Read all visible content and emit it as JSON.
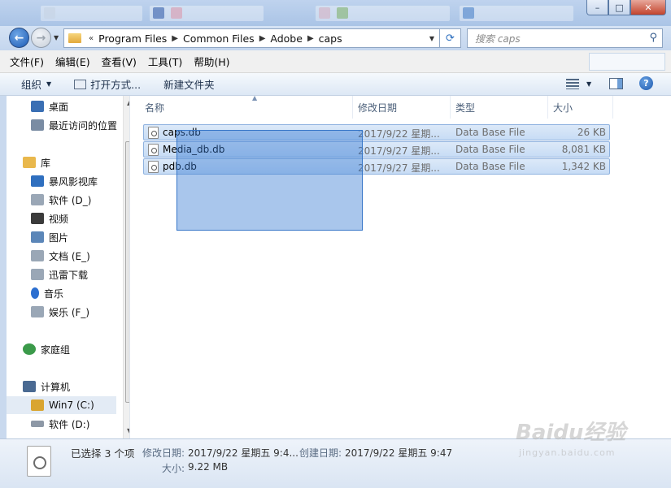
{
  "window": {
    "caption_buttons": {
      "minimize": "–",
      "maximize": "□",
      "close": "✕"
    }
  },
  "address": {
    "overflow": "«",
    "breadcrumbs": [
      "Program Files",
      "Common Files",
      "Adobe",
      "caps"
    ],
    "search_placeholder": "搜索 caps"
  },
  "menu": [
    "文件(F)",
    "编辑(E)",
    "查看(V)",
    "工具(T)",
    "帮助(H)"
  ],
  "toolbar": {
    "organize": "组织",
    "open_with": "打开方式...",
    "new_folder": "新建文件夹"
  },
  "nav_pane": {
    "items": [
      {
        "label": "桌面",
        "icon": "desktop-icon",
        "color": "#3a6fb4"
      },
      {
        "label": "最近访问的位置",
        "icon": "recent-places-icon",
        "color": "#7a8ca3"
      },
      {
        "label": "库",
        "icon": "library-icon",
        "color": "#e9b84c"
      },
      {
        "label": "暴风影视库",
        "icon": "video-library-icon",
        "color": "#2f6fbf"
      },
      {
        "label": "软件 (D_)",
        "icon": "drive-icon",
        "color": "#9aa7b6"
      },
      {
        "label": "视频",
        "icon": "video-icon",
        "color": "#3b3b3b"
      },
      {
        "label": "图片",
        "icon": "pictures-icon",
        "color": "#5b86b8"
      },
      {
        "label": "文档 (E_)",
        "icon": "documents-icon",
        "color": "#9aa7b6"
      },
      {
        "label": "迅雷下载",
        "icon": "download-icon",
        "color": "#9aa7b6"
      },
      {
        "label": "音乐",
        "icon": "music-icon",
        "color": "#2c6fd0"
      },
      {
        "label": "娱乐 (F_)",
        "icon": "drive-icon",
        "color": "#9aa7b6"
      },
      {
        "label": "家庭组",
        "icon": "homegroup-icon",
        "color": "#3b9a4a"
      },
      {
        "label": "计算机",
        "icon": "computer-icon",
        "color": "#4a6a92"
      },
      {
        "label": "Win7 (C:)",
        "icon": "windows-drive-icon",
        "color": "#d9a531"
      },
      {
        "label": "软件 (D:)",
        "icon": "hard-drive-icon",
        "color": "#8d98a6"
      }
    ]
  },
  "columns": {
    "name": "名称",
    "date": "修改日期",
    "type": "类型",
    "size": "大小"
  },
  "files": [
    {
      "name": "caps.db",
      "date": "2017/9/22 星期...",
      "type": "Data Base File",
      "size": "26 KB"
    },
    {
      "name": "Media_db.db",
      "date": "2017/9/27 星期...",
      "type": "Data Base File",
      "size": "8,081 KB"
    },
    {
      "name": "pdb.db",
      "date": "2017/9/27 星期...",
      "type": "Data Base File",
      "size": "1,342 KB"
    }
  ],
  "details": {
    "selected": "已选择 3 个项",
    "modified_label": "修改日期:",
    "modified_value": "2017/9/22 星期五 9:4...",
    "created_label": "创建日期:",
    "created_value": "2017/9/22 星期五 9:47",
    "size_label": "大小:",
    "size_value": "9.22 MB"
  },
  "watermark": {
    "logo": "Baidu经验",
    "url": "jingyan.baidu.com"
  }
}
